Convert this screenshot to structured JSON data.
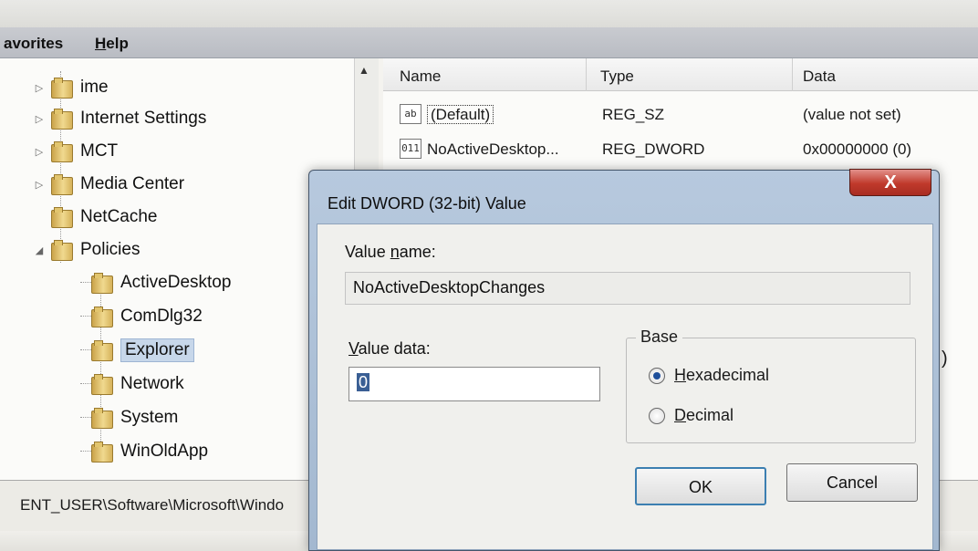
{
  "menubar": {
    "items": [
      {
        "label": "avorites",
        "accel": ""
      },
      {
        "label": "elp",
        "accel": "H"
      }
    ]
  },
  "tree": {
    "nodes": [
      {
        "label": "ime",
        "expander": "▷"
      },
      {
        "label": "Internet Settings",
        "expander": "▷"
      },
      {
        "label": "MCT",
        "expander": "▷"
      },
      {
        "label": "Media Center",
        "expander": "▷"
      },
      {
        "label": "NetCache",
        "expander": ""
      },
      {
        "label": "Policies",
        "expander": "◢"
      },
      {
        "label": "ActiveDesktop",
        "expander": ""
      },
      {
        "label": "ComDlg32",
        "expander": ""
      },
      {
        "label": "Explorer",
        "expander": "",
        "selected": true
      },
      {
        "label": "Network",
        "expander": ""
      },
      {
        "label": "System",
        "expander": ""
      },
      {
        "label": "WinOldApp",
        "expander": ""
      }
    ]
  },
  "list": {
    "headers": {
      "name": "Name",
      "type": "Type",
      "data": "Data"
    },
    "rows": [
      {
        "icon": "ab",
        "name": "(Default)",
        "type": "REG_SZ",
        "data": "(value not set)"
      },
      {
        "icon": "011",
        "name": "NoActiveDesktop...",
        "type": "REG_DWORD",
        "data": "0x00000000 (0)"
      }
    ],
    "peek": ")"
  },
  "statusbar": {
    "path": "ENT_USER\\Software\\Microsoft\\Windo"
  },
  "dialog": {
    "title": "Edit DWORD (32-bit) Value",
    "close": "X",
    "value_name_label_pre": "Value ",
    "value_name_label_accel": "n",
    "value_name_label_post": "ame:",
    "value_name": "NoActiveDesktopChanges",
    "value_data_label_accel": "V",
    "value_data_label_post": "alue data:",
    "value_data": "0",
    "base_label": "Base",
    "radio_hex_accel": "H",
    "radio_hex_post": "exadecimal",
    "radio_dec_accel": "D",
    "radio_dec_post": "ecimal",
    "base_selected": "Hexadecimal",
    "ok": "OK",
    "cancel": "Cancel"
  }
}
